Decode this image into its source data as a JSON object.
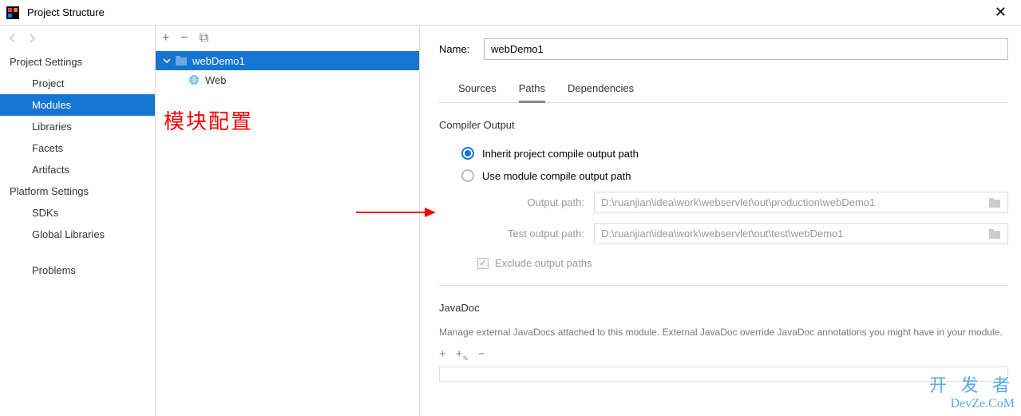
{
  "window": {
    "title": "Project Structure",
    "close_glyph": "✕"
  },
  "sidebar": {
    "sections": [
      {
        "header": "Project Settings",
        "items": [
          "Project",
          "Modules",
          "Libraries",
          "Facets",
          "Artifacts"
        ],
        "selected_index": 1
      },
      {
        "header": "Platform Settings",
        "items": [
          "SDKs",
          "Global Libraries"
        ]
      },
      {
        "header": "",
        "items": [
          "Problems"
        ]
      }
    ]
  },
  "tree": {
    "toolbar": {
      "add": "+",
      "remove": "−",
      "copy": "⧉"
    },
    "root": {
      "label": "webDemo1",
      "expanded": true
    },
    "children": [
      {
        "label": "Web"
      }
    ]
  },
  "annotation_cn": "模块配置",
  "main": {
    "name_label": "Name:",
    "name_value": "webDemo1",
    "tabs": [
      "Sources",
      "Paths",
      "Dependencies"
    ],
    "active_tab": 1,
    "compiler_output": {
      "title": "Compiler Output",
      "inherit_label": "Inherit project compile output path",
      "use_module_label": "Use module compile output path",
      "selected": "inherit",
      "output_path_label": "Output path:",
      "output_path_value": "D:\\ruanjian\\idea\\work\\webservlet\\out\\production\\webDemo1",
      "test_output_path_label": "Test output path:",
      "test_output_path_value": "D:\\ruanjian\\idea\\work\\webservlet\\out\\test\\webDemo1",
      "exclude_label": "Exclude output paths",
      "exclude_checked": true
    },
    "javadoc": {
      "title": "JavaDoc",
      "desc": "Manage external JavaDocs attached to this module. External JavaDoc override JavaDoc annotations you might have in your module.",
      "toolbar": {
        "add": "+",
        "add_url": "+⎋",
        "remove": "−"
      }
    }
  },
  "watermark": {
    "line1": "开 发 者",
    "line2": "DevZe.CoM"
  }
}
